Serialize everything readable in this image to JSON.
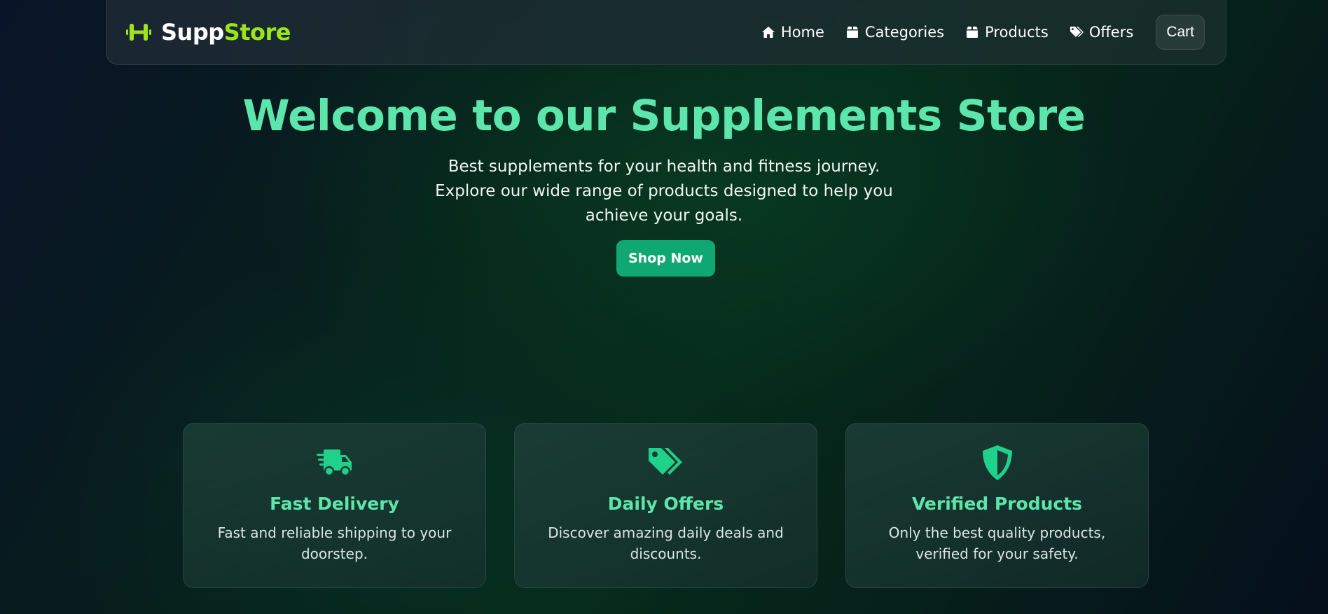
{
  "brand": {
    "name_part1": "Supp",
    "name_part2": "Store",
    "icon": "dumbbell-icon"
  },
  "nav": {
    "items": [
      {
        "label": "Home",
        "icon": "home-icon"
      },
      {
        "label": "Categories",
        "icon": "box-icon"
      },
      {
        "label": "Products",
        "icon": "box-icon"
      },
      {
        "label": "Offers",
        "icon": "tags-icon"
      }
    ],
    "cart_label": "Cart"
  },
  "hero": {
    "title": "Welcome to our Supplements Store",
    "subtitle": "Best supplements for your health and fitness journey. Explore our wide range of products designed to help you achieve your goals.",
    "cta_label": "Shop Now"
  },
  "features": [
    {
      "title": "Fast Delivery",
      "description": "Fast and reliable shipping to your doorstep.",
      "icon": "truck-fast-icon"
    },
    {
      "title": "Daily Offers",
      "description": "Discover amazing daily deals and discounts.",
      "icon": "tags-icon"
    },
    {
      "title": "Verified Products",
      "description": "Only the best quality products, verified for your safety.",
      "icon": "shield-icon"
    }
  ],
  "colors": {
    "accent_green": "#5de6ac",
    "brand_lime": "#9be51a",
    "button_green": "#0fa873",
    "icon_green": "#1fd18a"
  }
}
